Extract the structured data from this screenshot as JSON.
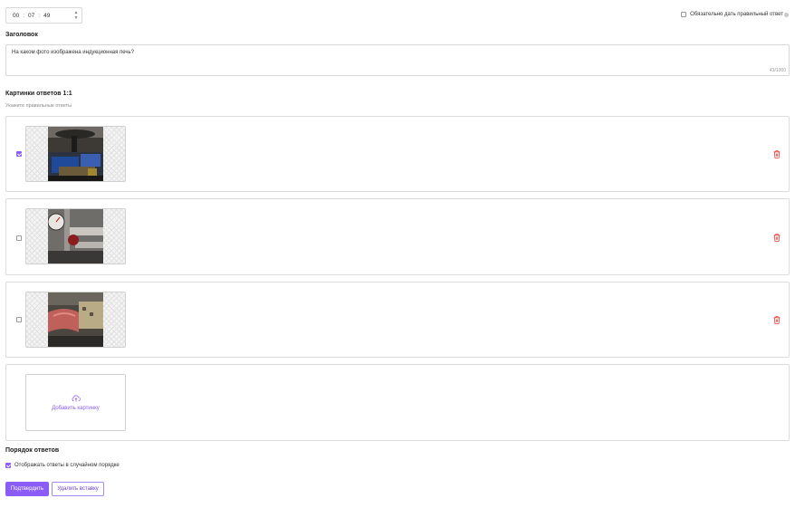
{
  "timer": {
    "hours": "00",
    "minutes": "07",
    "seconds": "49",
    "separator": ":"
  },
  "require_correct": {
    "label": "Обязательно дать правильный ответ",
    "checked": false
  },
  "heading": {
    "label": "Заголовок",
    "value": "На каком фото изображена индукционная печь?",
    "counter": "43/1000"
  },
  "answers_section": {
    "label": "Картинки ответов 1:1",
    "hint": "Укажите правильные ответы"
  },
  "answers": [
    {
      "checked": true,
      "photo": "induction-furnace-photo",
      "delete_icon": "trash-icon"
    },
    {
      "checked": false,
      "photo": "pressure-gauge-pipes-photo",
      "delete_icon": "trash-icon"
    },
    {
      "checked": false,
      "photo": "industrial-machinery-photo",
      "delete_icon": "trash-icon"
    }
  ],
  "upload": {
    "label": "Добавить картинку",
    "icon": "cloud-upload-icon"
  },
  "order": {
    "label": "Порядок ответов",
    "shuffle_label": "Отображать ответы в случайном порядке",
    "shuffle_checked": true
  },
  "buttons": {
    "confirm": "Подтвердить",
    "delete": "Удалить вставку"
  },
  "colors": {
    "accent": "#8b5cf6",
    "danger": "#e53935",
    "border": "#d8d8d8"
  }
}
